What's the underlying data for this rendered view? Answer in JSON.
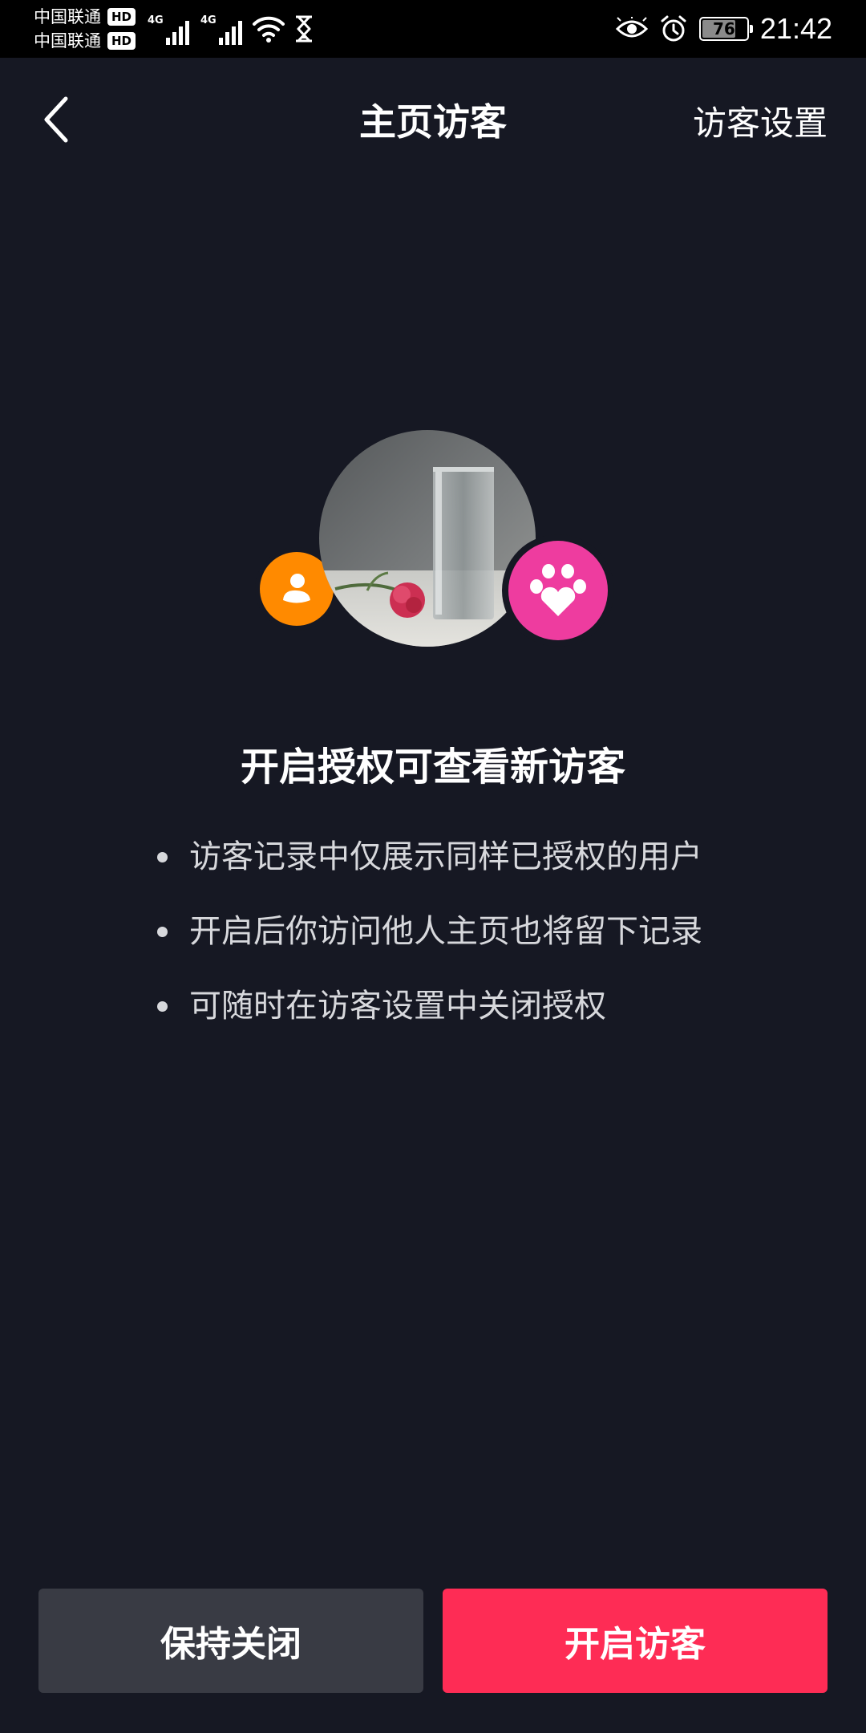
{
  "status_bar": {
    "carrier_1": "中国联通",
    "carrier_2": "中国联通",
    "hd_1": "HD",
    "hd_2": "HD",
    "network_1": "4G",
    "network_2": "4G",
    "battery": "76",
    "battery_level": 0.76,
    "time": "21:42",
    "icons": [
      "wifi-icon",
      "hourglass-icon",
      "eye-icon",
      "alarm-icon",
      "battery-icon"
    ]
  },
  "nav": {
    "title": "主页访客",
    "right_action": "访客设置",
    "back_icon": "chevron-left-icon"
  },
  "main": {
    "headline": "开启授权可查看新访客",
    "bullets": [
      "访客记录中仅展示同样已授权的用户",
      "开启后你访问他人主页也将留下记录",
      "可随时在访客设置中关闭授权"
    ]
  },
  "actions": {
    "keep_off": "保持关闭",
    "enable": "开启访客"
  },
  "colors": {
    "background": "#161823",
    "primary": "#fe2c55",
    "secondary_button": "#393b44",
    "badge_orange": "#ff8a00",
    "badge_pink": "#ee3c9f"
  }
}
